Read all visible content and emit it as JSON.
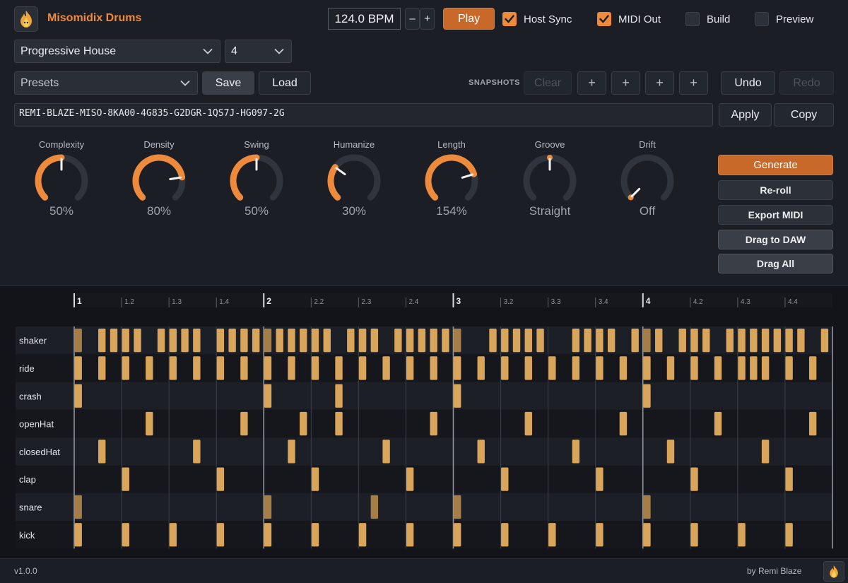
{
  "app": {
    "title": "Misomidix Drums"
  },
  "transport": {
    "bpm": "124.0 BPM",
    "minus": "–",
    "plus": "+",
    "play": "Play"
  },
  "toggles": [
    {
      "label": "Host Sync",
      "checked": true
    },
    {
      "label": "MIDI Out",
      "checked": true
    },
    {
      "label": "Build",
      "checked": false
    },
    {
      "label": "Preview",
      "checked": false
    }
  ],
  "genre": {
    "value": "Progressive House"
  },
  "bars": {
    "value": "4"
  },
  "presets": {
    "placeholder": "Presets",
    "save": "Save",
    "load": "Load"
  },
  "snapshots": {
    "label": "SNAPSHOTS",
    "clear": "Clear",
    "slots": [
      "+",
      "+",
      "+",
      "+"
    ]
  },
  "history": {
    "undo": "Undo",
    "redo": "Redo"
  },
  "seed": {
    "value": "REMI-BLAZE-MISO-8KA00-4G835-G2DGR-1QS7J-HG097-2G",
    "apply": "Apply",
    "copy": "Copy"
  },
  "knobs": [
    {
      "label": "Complexity",
      "value": "50%",
      "level": 0.5
    },
    {
      "label": "Density",
      "value": "80%",
      "level": 0.8
    },
    {
      "label": "Swing",
      "value": "50%",
      "level": 0.5
    },
    {
      "label": "Humanize",
      "value": "30%",
      "level": 0.3
    },
    {
      "label": "Length",
      "value": "154%",
      "level": 0.77
    },
    {
      "label": "Groove",
      "value": "Straight",
      "level": 0.5,
      "indicatorOnly": true
    },
    {
      "label": "Drift",
      "value": "Off",
      "level": 0.0,
      "indicatorOnly": true
    }
  ],
  "actions": {
    "generate": "Generate",
    "reroll": "Re-roll",
    "export": "Export MIDI",
    "drag_daw": "Drag to DAW",
    "drag_all": "Drag All"
  },
  "colors": {
    "accent": "#ee8a3c",
    "note": "#d9a55a",
    "note_dim": "#a47e46"
  },
  "ruler": [
    "1",
    "1.2",
    "1.3",
    "1.4",
    "2",
    "2.2",
    "2.3",
    "2.4",
    "3",
    "3.2",
    "3.3",
    "3.4",
    "4",
    "4.2",
    "4.3",
    "4.4"
  ],
  "tracks": [
    {
      "name": "shaker",
      "steps": [
        2,
        3,
        4,
        5,
        7,
        8,
        9,
        10,
        12,
        13,
        14,
        15,
        16,
        17,
        18,
        19,
        20,
        21,
        23,
        24,
        25,
        27,
        28,
        29,
        30,
        31,
        35,
        36,
        37,
        38,
        39,
        42,
        43,
        44,
        45,
        47,
        48,
        49,
        51,
        52,
        53,
        55,
        56,
        57,
        58,
        59,
        60,
        61,
        63
      ],
      "dim": [
        0,
        16,
        32,
        48
      ]
    },
    {
      "name": "ride",
      "steps": [
        0,
        2,
        4,
        6,
        8,
        10,
        12,
        14,
        16,
        18,
        20,
        22,
        24,
        26,
        28,
        30,
        32,
        34,
        36,
        38,
        40,
        42,
        44,
        46,
        48,
        50,
        52,
        54,
        56,
        57,
        58,
        60,
        62
      ]
    },
    {
      "name": "crash",
      "steps": [
        0,
        16,
        22,
        32,
        48
      ]
    },
    {
      "name": "openHat",
      "steps": [
        6,
        14,
        19,
        22,
        30,
        38,
        46,
        54,
        62
      ]
    },
    {
      "name": "closedHat",
      "steps": [
        2,
        10,
        18,
        26,
        34,
        42,
        50,
        58
      ]
    },
    {
      "name": "clap",
      "steps": [
        4,
        12,
        20,
        28,
        36,
        44,
        52,
        60
      ]
    },
    {
      "name": "snare",
      "steps": [
        0,
        16,
        25,
        32,
        48
      ],
      "dim": [
        0,
        16,
        25,
        32,
        48
      ]
    },
    {
      "name": "kick",
      "steps": [
        0,
        4,
        8,
        12,
        16,
        20,
        24,
        28,
        32,
        36,
        40,
        44,
        48,
        52,
        56,
        60
      ]
    }
  ],
  "footer": {
    "version": "v1.0.0",
    "credit": "by Remi Blaze"
  }
}
